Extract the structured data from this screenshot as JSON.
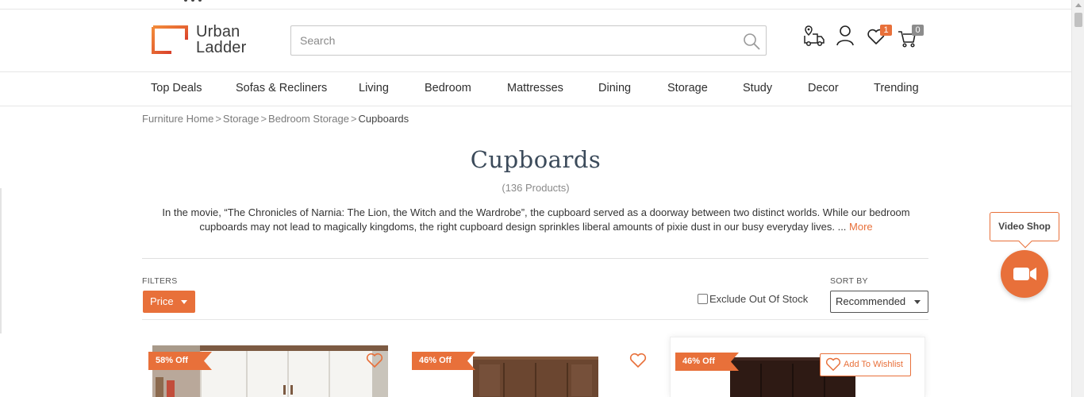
{
  "brand": {
    "name_line1": "Urban",
    "name_line2": "Ladder",
    "accent_color": "#e8703a"
  },
  "search": {
    "placeholder": "Search"
  },
  "header_icons": {
    "track_icon": "truck-location-icon",
    "account_icon": "user-icon",
    "wishlist_icon": "heart-icon",
    "wishlist_count": "1",
    "cart_icon": "cart-icon",
    "cart_count": "0"
  },
  "nav": [
    "Top Deals",
    "Sofas & Recliners",
    "Living",
    "Bedroom",
    "Mattresses",
    "Dining",
    "Storage",
    "Study",
    "Decor",
    "Trending"
  ],
  "breadcrumb": {
    "items": [
      "Furniture Home",
      "Storage",
      "Bedroom Storage"
    ],
    "current": "Cupboards",
    "separator": ">"
  },
  "page": {
    "title": "Cupboards",
    "count": "(136 Products)",
    "description": "In the movie, “The Chronicles of Narnia: The Lion, the Witch and the Wardrobe”, the cupboard served as a doorway between two distinct worlds. While our bedroom cupboards may not lead to magically kingdoms, the right cupboard design sprinkles liberal amounts of pixie dust in our busy everyday lives. ...",
    "more_label": "More"
  },
  "filters": {
    "label": "FILTERS",
    "price_label": "Price",
    "exclude_label": "Exclude Out Of Stock",
    "exclude_checked": false
  },
  "sort": {
    "label": "SORT BY",
    "selected": "Recommended"
  },
  "video_shop": {
    "label": "Video Shop",
    "icon": "video-camera-icon"
  },
  "products": [
    {
      "discount": "58% Off",
      "wishlisted": false
    },
    {
      "discount": "46% Off",
      "wishlisted": false
    },
    {
      "discount": "46% Off",
      "wishlisted": false,
      "wishlist_label": "Add To Wishlist"
    }
  ]
}
